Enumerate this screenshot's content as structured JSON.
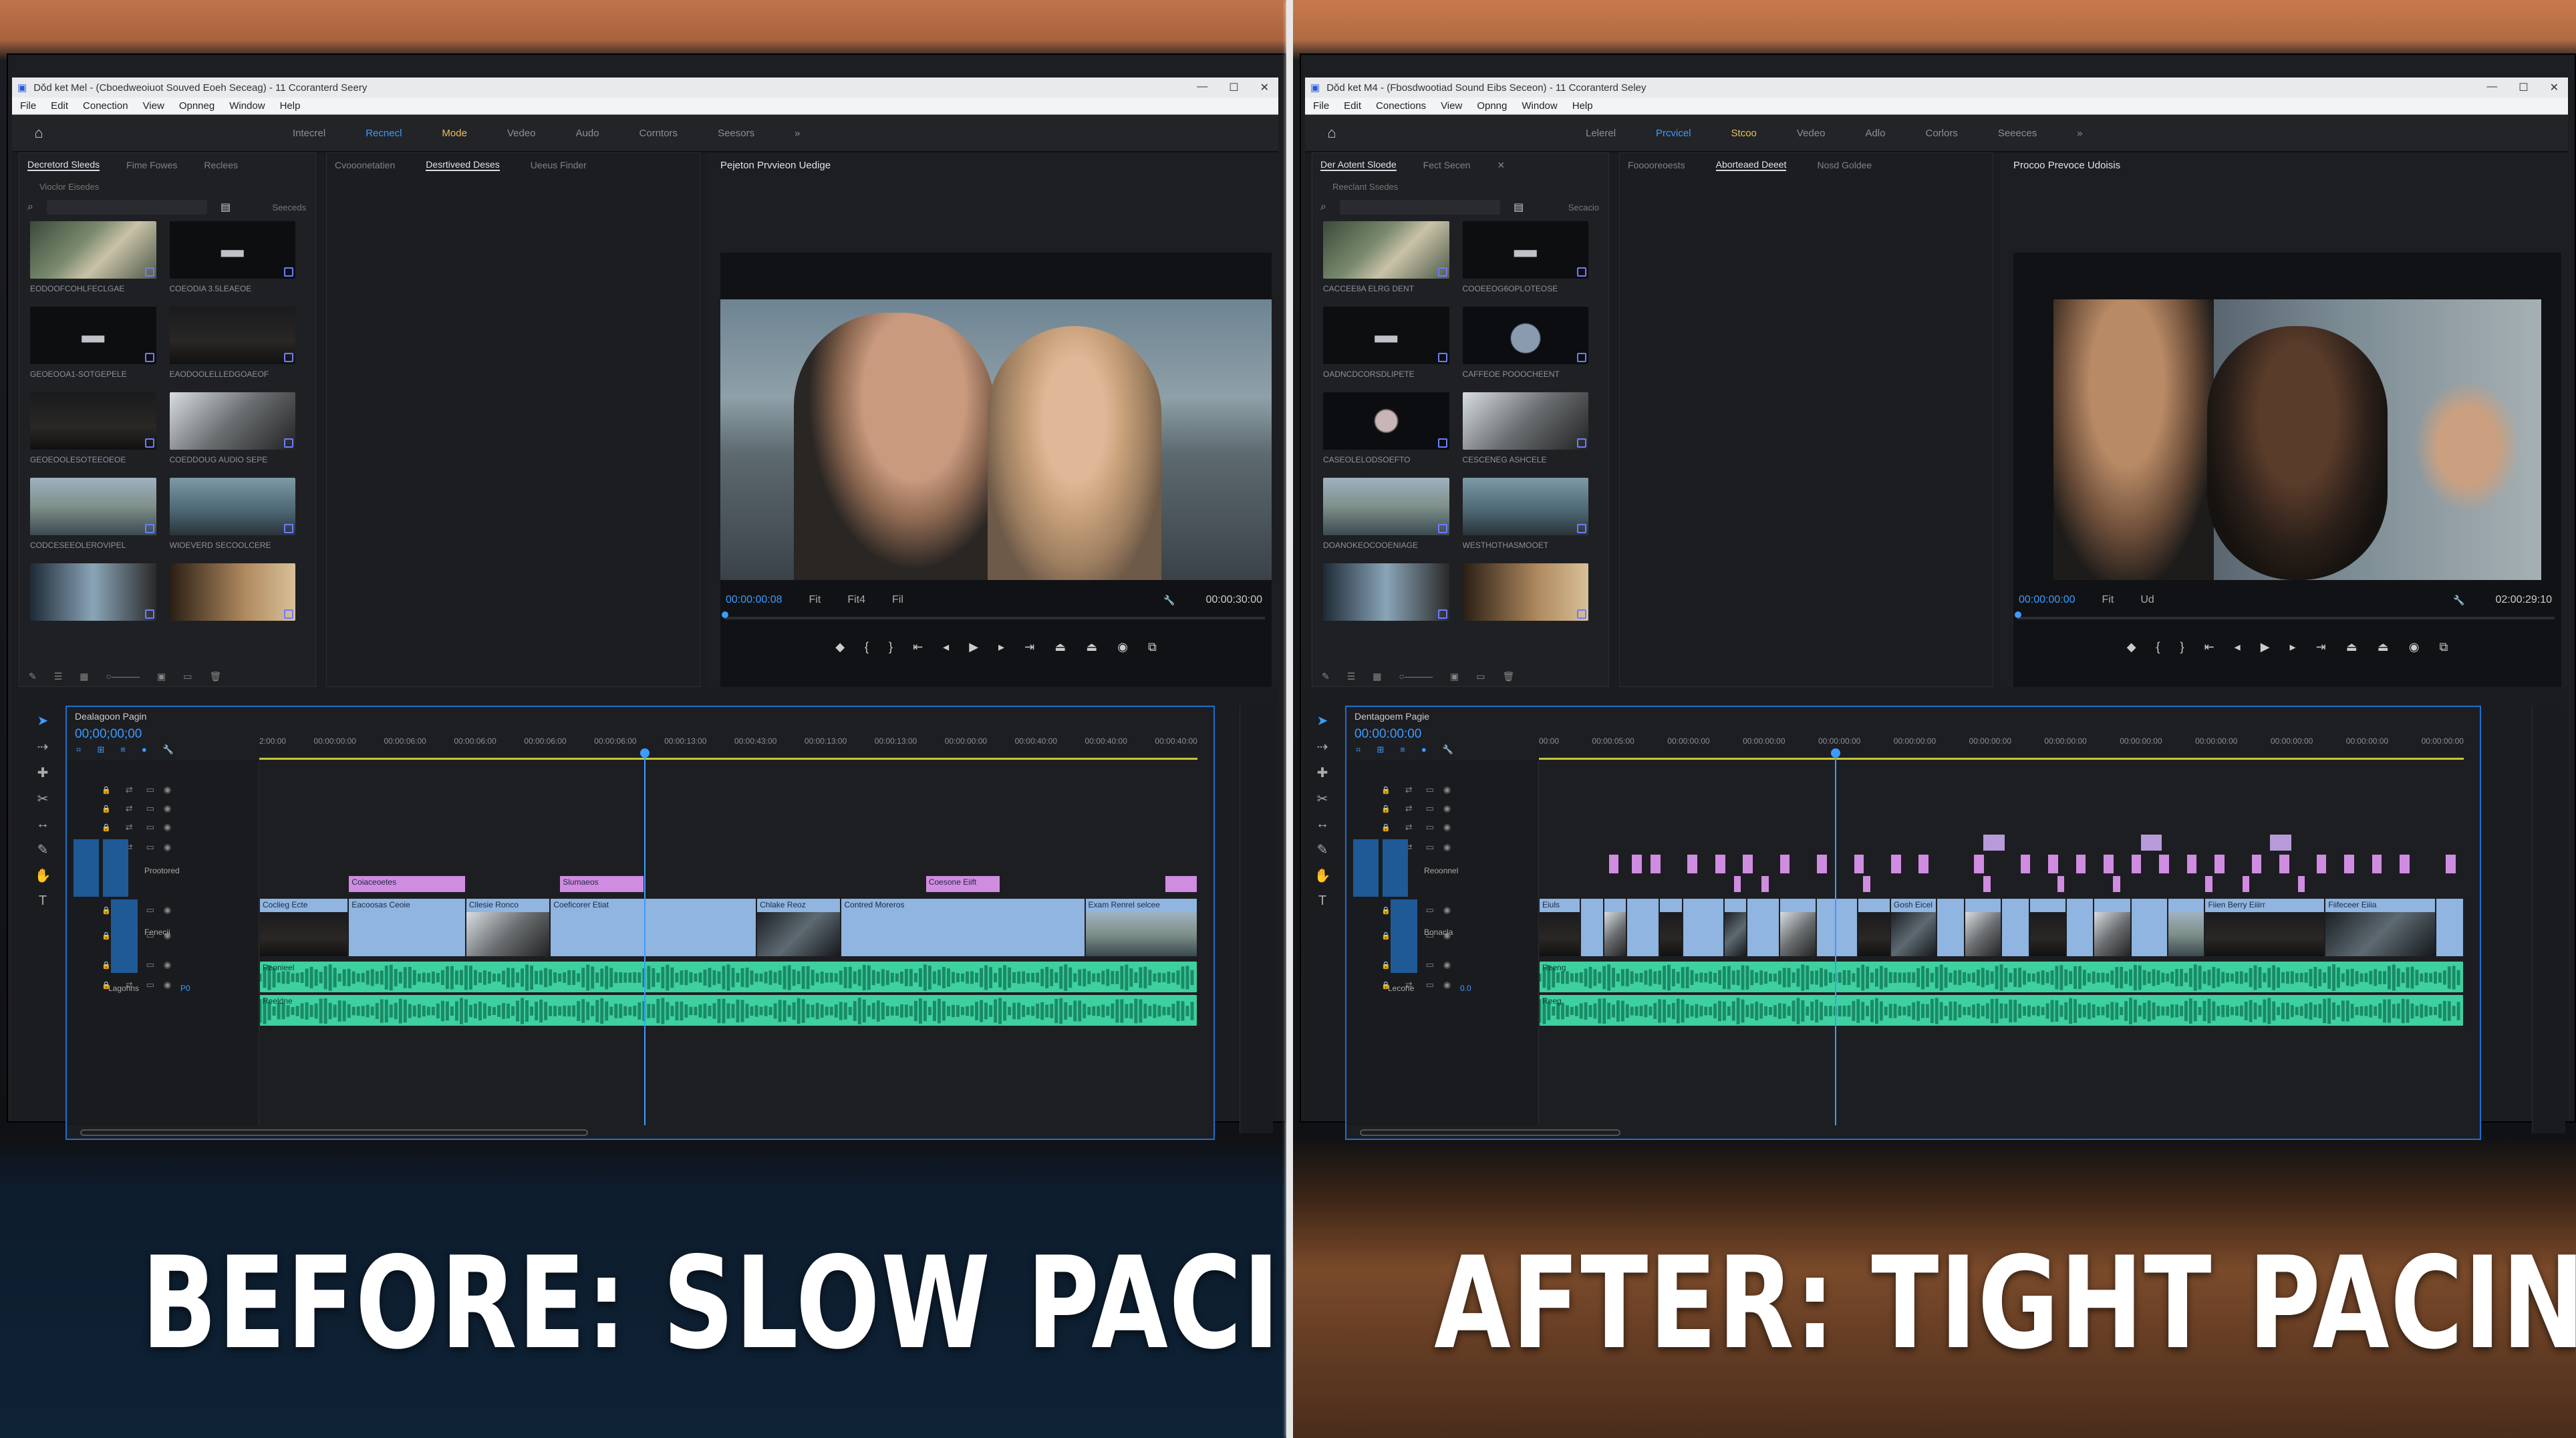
{
  "left": {
    "window_title": "Dǒd ket Mel - (Cboedweoiuot Souved Eoeh Seceag) - 11 Ccoranterd Seery",
    "window_controls": [
      "—",
      "☐",
      "✕"
    ],
    "menu": [
      "File",
      "Edit",
      "Conection",
      "View",
      "Opnneg",
      "Window",
      "Help"
    ],
    "workspaces": [
      {
        "label": "Intecrel",
        "state": "normal"
      },
      {
        "label": "Recnecl",
        "state": "active"
      },
      {
        "label": "Mode",
        "state": "mode"
      },
      {
        "label": "Vedeo",
        "state": "normal"
      },
      {
        "label": "Audo",
        "state": "normal"
      },
      {
        "label": "Corntors",
        "state": "normal"
      },
      {
        "label": "Seesors",
        "state": "normal"
      },
      {
        "label": "»",
        "state": "normal"
      }
    ],
    "project_tabs": [
      "Decretord Sleeds",
      "Fime Fowes",
      "Reclees"
    ],
    "project_folder": "Vioclor Eisedes",
    "search_placeholder": "",
    "item_count": "Seeceds",
    "bins": [
      {
        "name": "EODOOFCOHLFECLGAE",
        "kind": "woman"
      },
      {
        "name": "COEODIA 3.5LEAEOE",
        "kind": "folder"
      },
      {
        "name": "GEOEOOA1-SOTGEPELE",
        "kind": "folder"
      },
      {
        "name": "EAODOOLELLEDGOAEOF",
        "kind": "dark"
      },
      {
        "name": "GEOEOOLESOTEEOEOE",
        "kind": "dark"
      },
      {
        "name": "COEDDOUG AUDIO SEPE",
        "kind": "man"
      },
      {
        "name": "CODCESEEOLEROVIPEL",
        "kind": "coast"
      },
      {
        "name": "WIOEVERD SECOOLCERE",
        "kind": "person"
      },
      {
        "name": "",
        "kind": "warm"
      },
      {
        "name": "",
        "kind": "warm2"
      }
    ],
    "mid_tabs": [
      "Cvooonetatien",
      "Desrtiveed Deses",
      "Ueeus Finder"
    ],
    "program_title": "Pejeton Prvvieon Uedige",
    "timecode": "00:00:00:08",
    "fit": "Fit",
    "res_a": "Fit4",
    "res_b": "Fil",
    "duration": "00:00:30:00",
    "sequence_name": "Dealagoon Pagin",
    "seq_timecode": "00;00;00;00",
    "ruler": [
      "2:00:00",
      "00:00:00:00",
      "00:00:06:00",
      "00:00:06:00",
      "00:00:06:00",
      "00:00:06:00",
      "00:00:13:00",
      "00:00:43:00",
      "00:00:13:00",
      "00:00:13:00",
      "00:00:00:00",
      "00:00:40:00",
      "00:00:40:00",
      "00:00:40:00"
    ],
    "track_label": "Prootored",
    "audio_label": "Fenecii",
    "lock_label": "Lagonns",
    "lock_value": "P0",
    "pink_clips": [
      {
        "label": "Coiaceoetes",
        "start": 0.095,
        "end": 0.22
      },
      {
        "label": "Slumaeos",
        "start": 0.32,
        "end": 0.41
      },
      {
        "label": "Coesone Eiift",
        "start": 0.71,
        "end": 0.79
      },
      {
        "label": "",
        "start": 0.965,
        "end": 1.0
      }
    ],
    "video_clips": [
      {
        "label": "Coclieg Ecte",
        "start": 0.0,
        "end": 0.095,
        "shot": "dark"
      },
      {
        "label": "Eacoosas Ceoie",
        "start": 0.095,
        "end": 0.22,
        "shot": "blank"
      },
      {
        "label": "Cllesie Ronco",
        "start": 0.22,
        "end": 0.31,
        "shot": "man"
      },
      {
        "label": "Coeficorer Etiat",
        "start": 0.31,
        "end": 0.53,
        "shot": "blank"
      },
      {
        "label": "Chlake Reoz",
        "start": 0.53,
        "end": 0.62,
        "shot": "car"
      },
      {
        "label": "Contred Moreros",
        "start": 0.62,
        "end": 0.88,
        "shot": "blank"
      },
      {
        "label": "Exam Renrel selcee",
        "start": 0.88,
        "end": 1.0,
        "shot": "coast"
      }
    ],
    "audio_clips": [
      {
        "label": "Reonieel",
        "start": 0.0,
        "end": 1.0
      },
      {
        "label": "Reeldne",
        "start": 0.0,
        "end": 1.0
      }
    ],
    "playhead": 0.41,
    "caption": "BEFORE: SLOW PACING"
  },
  "right": {
    "window_title": "Dǒd ket M4 - (Fbosdwootiad Sound Eibs Seceon) - 11 Ccoranterd Seley",
    "window_controls": [
      "—",
      "☐",
      "✕"
    ],
    "menu": [
      "File",
      "Edit",
      "Conections",
      "View",
      "Opnng",
      "Window",
      "Help"
    ],
    "workspaces": [
      {
        "label": "Lelerel",
        "state": "normal"
      },
      {
        "label": "Prcvicel",
        "state": "active"
      },
      {
        "label": "Stcoo",
        "state": "mode"
      },
      {
        "label": "Vedeo",
        "state": "normal"
      },
      {
        "label": "Adlo",
        "state": "normal"
      },
      {
        "label": "Corlors",
        "state": "normal"
      },
      {
        "label": "Seeeces",
        "state": "normal"
      },
      {
        "label": "»",
        "state": "normal"
      }
    ],
    "project_tabs": [
      "Der Aotent Sloede",
      "Fect Secen",
      "✕"
    ],
    "project_folder": "Reeclant Ssedes",
    "search_placeholder": "",
    "item_count": "Secacio",
    "bins": [
      {
        "name": "CACCEE8A ELRG DENT",
        "kind": "woman"
      },
      {
        "name": "COOEEOG6OPLOTEOSE",
        "kind": "folder"
      },
      {
        "name": "OADNCDCORSDLIPETE",
        "kind": "folder"
      },
      {
        "name": "CAFFEOE POOOCHEENT",
        "kind": "small"
      },
      {
        "name": "CASEOLELODSOEFTO",
        "kind": "flag"
      },
      {
        "name": "CESCENEG ASHCELE",
        "kind": "man"
      },
      {
        "name": "DOANOKEOCOOENIAGE",
        "kind": "coast"
      },
      {
        "name": "WESTHOTHASMOOET",
        "kind": "person"
      },
      {
        "name": "",
        "kind": "warm"
      },
      {
        "name": "",
        "kind": "warm2"
      }
    ],
    "mid_tabs": [
      "Fooooreoests",
      "Aborteaed Deeet",
      "Nosd Goldee"
    ],
    "program_title": "Procoo Prevoce Udoisis",
    "timecode": "00:00:00:00",
    "fit": "Fit",
    "res_a": "Ud",
    "res_b": "",
    "duration": "02:00:29:10",
    "sequence_name": "Dentagoem Pagie",
    "seq_timecode": "00:00:00:00",
    "ruler": [
      "00:00",
      "00:00:05:00",
      "00:00:00:00",
      "00:00:00:00",
      "00:00:00:00",
      "00:00:00:00",
      "00:00:00:00",
      "00:00:00:00",
      "00:00:00:00",
      "00:00:00:00",
      "00:00:00:00",
      "00:00:00:00",
      "00:00:00:00"
    ],
    "track_label": "Reoonnel",
    "audio_label": "Bonacla",
    "lock_label": "Lecone",
    "lock_value": "0.0",
    "pink_marks": [
      0.075,
      0.1,
      0.12,
      0.16,
      0.19,
      0.22,
      0.26,
      0.3,
      0.34,
      0.38,
      0.41,
      0.47,
      0.52,
      0.55,
      0.58,
      0.61,
      0.64,
      0.67,
      0.7,
      0.73,
      0.77,
      0.8,
      0.84,
      0.87,
      0.9,
      0.93,
      0.98
    ],
    "pink_marks2": [
      0.21,
      0.24,
      0.35,
      0.48,
      0.56,
      0.62,
      0.72,
      0.76,
      0.82
    ],
    "video_clips": [
      {
        "label": "Eiuls",
        "start": 0.0,
        "end": 0.045,
        "shot": "dark"
      },
      {
        "label": "",
        "start": 0.045,
        "end": 0.07,
        "shot": "blank"
      },
      {
        "label": "",
        "start": 0.07,
        "end": 0.095,
        "shot": "man"
      },
      {
        "label": "",
        "start": 0.095,
        "end": 0.13,
        "shot": "blank"
      },
      {
        "label": "",
        "start": 0.13,
        "end": 0.155,
        "shot": "dark"
      },
      {
        "label": "",
        "start": 0.155,
        "end": 0.2,
        "shot": "blank"
      },
      {
        "label": "",
        "start": 0.2,
        "end": 0.225,
        "shot": "car"
      },
      {
        "label": "",
        "start": 0.225,
        "end": 0.26,
        "shot": "blank"
      },
      {
        "label": "",
        "start": 0.26,
        "end": 0.3,
        "shot": "man"
      },
      {
        "label": "",
        "start": 0.3,
        "end": 0.345,
        "shot": "blank"
      },
      {
        "label": "",
        "start": 0.345,
        "end": 0.38,
        "shot": "dark"
      },
      {
        "label": "Gosh Eicel",
        "start": 0.38,
        "end": 0.43,
        "shot": "car"
      },
      {
        "label": "",
        "start": 0.43,
        "end": 0.46,
        "shot": "blank"
      },
      {
        "label": "",
        "start": 0.46,
        "end": 0.5,
        "shot": "man"
      },
      {
        "label": "",
        "start": 0.5,
        "end": 0.53,
        "shot": "blank"
      },
      {
        "label": "",
        "start": 0.53,
        "end": 0.57,
        "shot": "dark"
      },
      {
        "label": "",
        "start": 0.57,
        "end": 0.6,
        "shot": "blank"
      },
      {
        "label": "",
        "start": 0.6,
        "end": 0.64,
        "shot": "man"
      },
      {
        "label": "",
        "start": 0.64,
        "end": 0.68,
        "shot": "blank"
      },
      {
        "label": "",
        "start": 0.68,
        "end": 0.72,
        "shot": "coast"
      },
      {
        "label": "Fiien Berry Eiiirr",
        "start": 0.72,
        "end": 0.85,
        "shot": "dark"
      },
      {
        "label": "Fiifeceer Eiiia",
        "start": 0.85,
        "end": 0.97,
        "shot": "car"
      },
      {
        "label": "",
        "start": 0.97,
        "end": 1.0,
        "shot": "blank"
      }
    ],
    "audio_clips": [
      {
        "label": "Reeng",
        "start": 0.0,
        "end": 1.0
      },
      {
        "label": "Reeg",
        "start": 0.0,
        "end": 1.0
      }
    ],
    "playhead": 0.32,
    "caption": "AFTER: TIGHT PACING"
  }
}
